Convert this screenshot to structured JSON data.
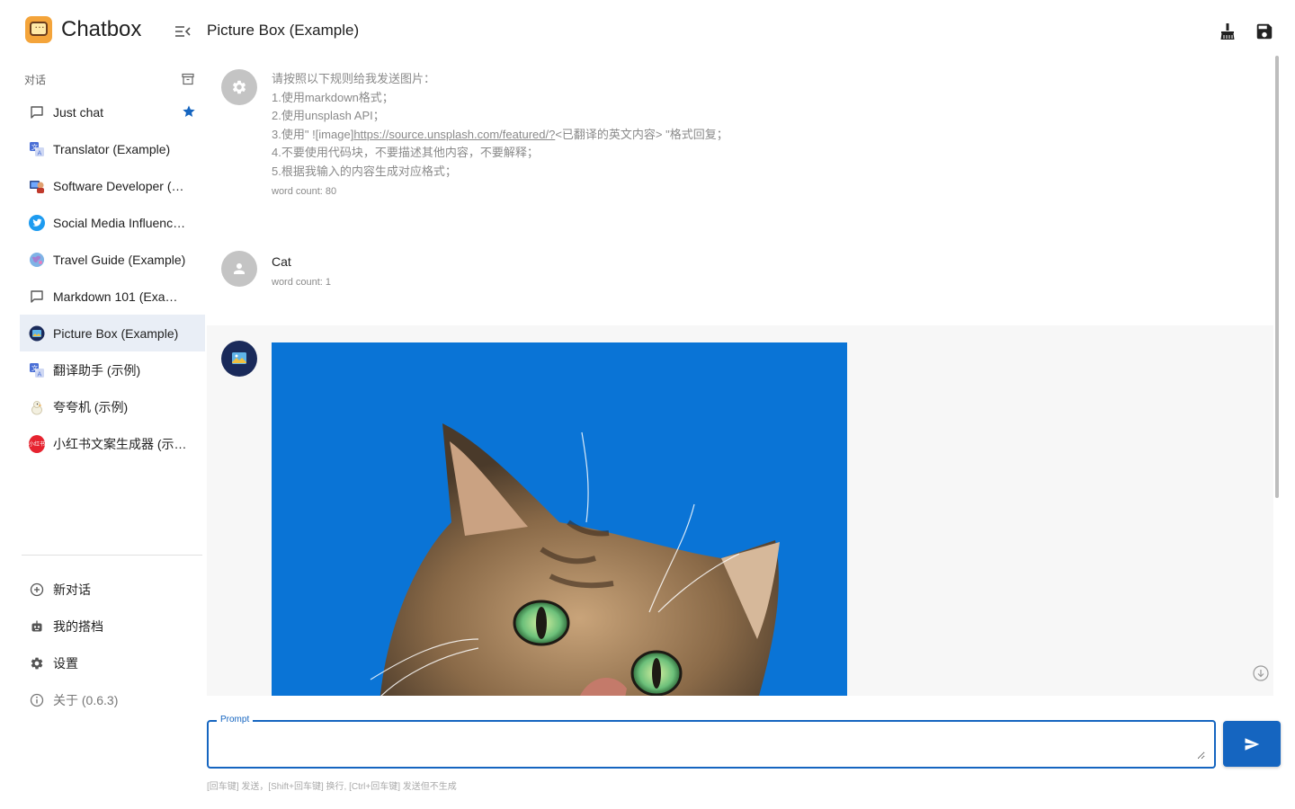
{
  "app": {
    "name": "Chatbox"
  },
  "sidebar": {
    "section_title": "对话",
    "conversations": [
      {
        "label": "Just chat",
        "icon": "chat-bubble-icon",
        "starred": true
      },
      {
        "label": "Translator (Example)",
        "icon": "translate-avatar"
      },
      {
        "label": "Software Developer (…",
        "icon": "developer-avatar"
      },
      {
        "label": "Social Media Influenc…",
        "icon": "twitter-avatar"
      },
      {
        "label": "Travel Guide (Example)",
        "icon": "globe-avatar"
      },
      {
        "label": "Markdown 101 (Exam…",
        "icon": "chat-bubble-icon"
      },
      {
        "label": "Picture Box (Example)",
        "icon": "picture-avatar",
        "active": true
      },
      {
        "label": "翻译助手 (示例)",
        "icon": "translate-avatar"
      },
      {
        "label": "夸夸机 (示例)",
        "icon": "duck-avatar"
      },
      {
        "label": "小红书文案生成器 (示…",
        "icon": "xiaohongshu-avatar",
        "avatar_text": "小红书"
      }
    ],
    "menu": {
      "new_chat": "新对话",
      "my_copilots": "我的搭档",
      "settings": "设置",
      "about": "关于 (0.6.3)"
    }
  },
  "header": {
    "title": "Picture Box (Example)"
  },
  "messages": {
    "system": {
      "lines": [
        "请按照以下规则给我发送图片：",
        "1.使用markdown格式；",
        "2.使用unsplash API；"
      ],
      "line3_prefix": "3.使用\" ![image]",
      "line3_link": "https://source.unsplash.com/featured/?",
      "line3_suffix": "<已翻译的英文内容> \"格式回复；",
      "lines_after": [
        "4.不要使用代码块，不要描述其他内容，不要解释；",
        "5.根据我输入的内容生成对应格式；"
      ],
      "word_count": "word count: 80"
    },
    "user": {
      "text": "Cat",
      "word_count": "word count: 1"
    }
  },
  "input": {
    "label": "Prompt",
    "value": "",
    "hint": "[回车键] 发送，[Shift+回车键] 换行, [Ctrl+回车键] 发送但不生成"
  },
  "colors": {
    "accent": "#1565c0",
    "active_item_bg": "#e9eef6",
    "image_sky": "#0a74d6",
    "assistant_bg": "#f7f7f7"
  }
}
